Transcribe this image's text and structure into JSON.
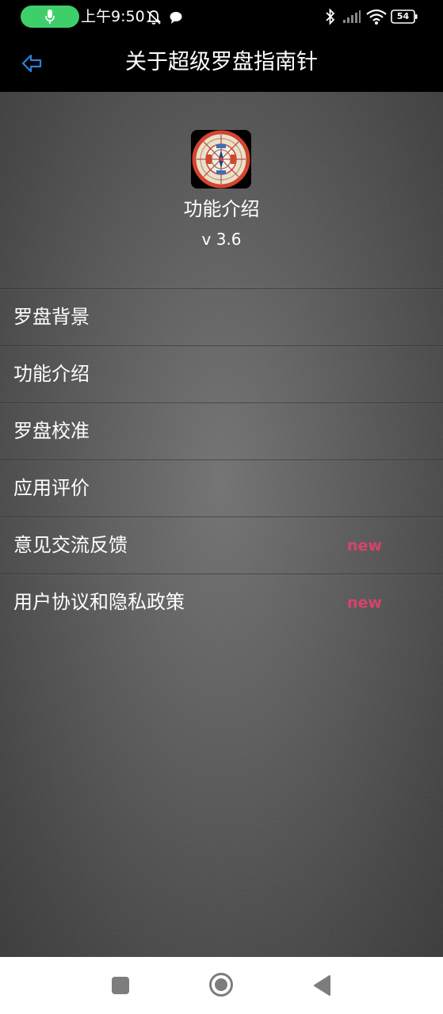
{
  "status_bar": {
    "time": "上午9:50",
    "battery": "54",
    "icons": [
      "microphone-icon",
      "mute-notification-icon",
      "chat-icon",
      "bluetooth-icon",
      "cell-signal-icon",
      "wifi-icon",
      "battery-icon"
    ],
    "mic_color": "#3fcf6a"
  },
  "header": {
    "title": "关于超级罗盘指南针",
    "back_icon": "back-arrow-icon",
    "accent": "#2f7fd6"
  },
  "about": {
    "logo_icon": "compass-logo-icon",
    "app_name": "功能介绍",
    "version": "v 3.6"
  },
  "menu": {
    "items": [
      {
        "label": "罗盘背景",
        "badge": ""
      },
      {
        "label": "功能介绍",
        "badge": ""
      },
      {
        "label": "罗盘校准",
        "badge": ""
      },
      {
        "label": "应用评价",
        "badge": ""
      },
      {
        "label": "意见交流反馈",
        "badge": "new"
      },
      {
        "label": "用户协议和隐私政策",
        "badge": "new"
      }
    ],
    "badge_color": "#d8436b"
  },
  "nav_bar": {
    "icons": [
      "recent-apps-icon",
      "home-icon",
      "back-icon"
    ]
  }
}
